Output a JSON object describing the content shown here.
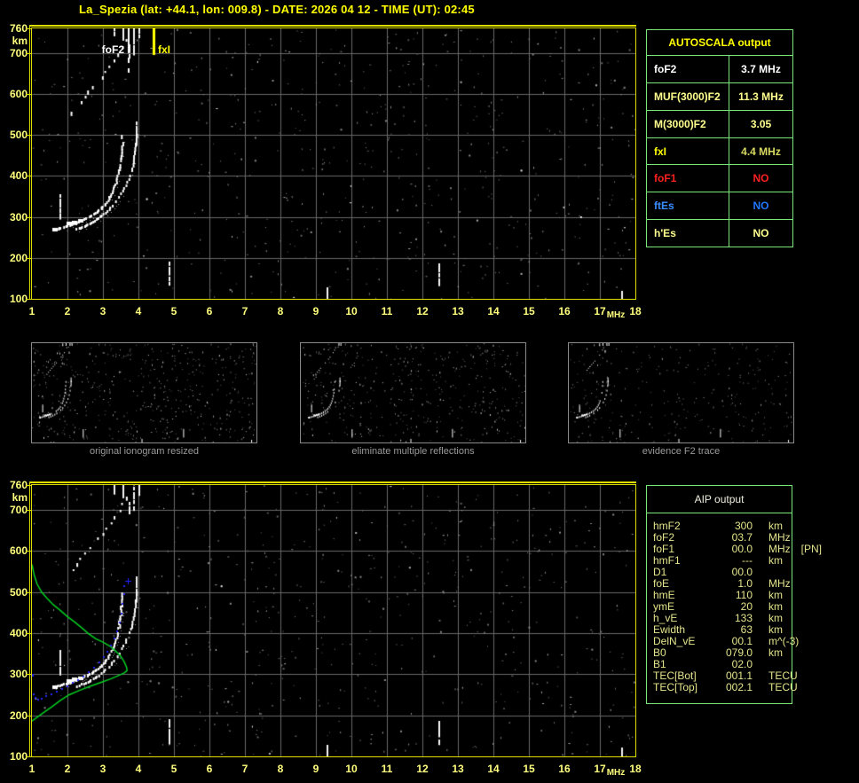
{
  "title": "La_Spezia (lat: +44.1, lon: 009.8) - DATE: 2026 04 12 - TIME (UT): 02:45",
  "colors": {
    "accent_yellow": "#ffff00",
    "pale_yellow": "#ffff8e",
    "tick_yellow": "#ffff7d",
    "table_green_border": "#79e879",
    "grid_grey": "#696969",
    "profile_green": "#00d022",
    "fit_blue": "#2424ff",
    "alert_red": "#ff2020",
    "info_blue": "#3b8eff"
  },
  "top_plot": {
    "fof2_label": "foF2",
    "fxi_label": "fxI"
  },
  "autoscala": {
    "header": "AUTOSCALA output",
    "rows": [
      {
        "label": "foF2",
        "value": "3.7 MHz",
        "label_color": "#ffffff",
        "value_color": "#ffffff"
      },
      {
        "label": "MUF(3000)F2",
        "value": "11.3 MHz",
        "label_color": "#ffff8e",
        "value_color": "#ffff8e"
      },
      {
        "label": "M(3000)F2",
        "value": "3.05",
        "label_color": "#ffff8e",
        "value_color": "#ffff8e"
      },
      {
        "label": "fxI",
        "value": "4.4 MHz",
        "label_color": "#ffff00",
        "value_color": "#d8d860"
      },
      {
        "label": "foF1",
        "value": "NO",
        "label_color": "#ff2020",
        "value_color": "#ff2020"
      },
      {
        "label": "ftEs",
        "value": "NO",
        "label_color": "#3b8eff",
        "value_color": "#2277ff"
      },
      {
        "label": "h'Es",
        "value": "NO",
        "label_color": "#ffff8e",
        "value_color": "#ffff8e"
      }
    ]
  },
  "thumbnails": [
    {
      "caption": "original ionogram resized"
    },
    {
      "caption": "eliminate multiple reflections"
    },
    {
      "caption": "evidence F2 trace"
    }
  ],
  "aip": {
    "header": "AIP output",
    "rows": [
      {
        "label": "hmF2",
        "value": "300",
        "unit": "km",
        "extra": ""
      },
      {
        "label": "foF2",
        "value": "03.7",
        "unit": "MHz",
        "extra": ""
      },
      {
        "label": "foF1",
        "value": "00.0",
        "unit": "MHz",
        "extra": "[PN]"
      },
      {
        "label": "hmF1",
        "value": "---",
        "unit": "km",
        "extra": ""
      },
      {
        "label": "D1",
        "value": "00.0",
        "unit": "",
        "extra": ""
      },
      {
        "label": "foE",
        "value": "1.0",
        "unit": "MHz",
        "extra": ""
      },
      {
        "label": "hmE",
        "value": "110",
        "unit": "km",
        "extra": ""
      },
      {
        "label": "ymE",
        "value": "20",
        "unit": "km",
        "extra": ""
      },
      {
        "label": "h_vE",
        "value": "133",
        "unit": "km",
        "extra": ""
      },
      {
        "label": "Ewidth",
        "value": "63",
        "unit": "km",
        "extra": ""
      },
      {
        "label": "DelN_vE",
        "value": "00.1",
        "unit": "m^(-3)",
        "extra": ""
      },
      {
        "label": "B0",
        "value": "079.0",
        "unit": "km",
        "extra": ""
      },
      {
        "label": "B1",
        "value": "02.0",
        "unit": "",
        "extra": ""
      },
      {
        "label": "TEC[Bot]",
        "value": "001.1",
        "unit": "TECU",
        "extra": ""
      },
      {
        "label": "TEC[Top]",
        "value": "002.1",
        "unit": "TECU",
        "extra": ""
      }
    ]
  },
  "chart_data": [
    {
      "id": "top_ionogram",
      "type": "scatter",
      "title": "ionogram with autoscaled characteristics",
      "xlabel": "MHz",
      "ylabel": "km",
      "xlim": [
        1,
        18
      ],
      "ylim": [
        100,
        760
      ],
      "x_ticks": [
        1,
        2,
        3,
        4,
        5,
        6,
        7,
        8,
        9,
        10,
        11,
        12,
        13,
        14,
        15,
        16,
        17,
        18
      ],
      "y_ticks": [
        760,
        700,
        600,
        500,
        400,
        300,
        200,
        100
      ],
      "grid": true,
      "markers": {
        "foF2_MHz": 3.7,
        "fxI_MHz": 4.4
      },
      "series": [
        {
          "name": "F2 O-mode trace",
          "points": [
            [
              1.6,
              272
            ],
            [
              1.72,
              274
            ],
            [
              1.84,
              277
            ],
            [
              1.96,
              280
            ],
            [
              2.08,
              283
            ],
            [
              2.2,
              287
            ],
            [
              2.32,
              291
            ],
            [
              2.44,
              296
            ],
            [
              2.56,
              301
            ],
            [
              2.68,
              307
            ],
            [
              2.8,
              314
            ],
            [
              2.92,
              322
            ],
            [
              3.02,
              331
            ],
            [
              3.12,
              342
            ],
            [
              3.2,
              354
            ],
            [
              3.27,
              367
            ],
            [
              3.33,
              381
            ],
            [
              3.38,
              397
            ],
            [
              3.43,
              415
            ],
            [
              3.47,
              436
            ],
            [
              3.5,
              458
            ],
            [
              3.52,
              482
            ],
            [
              3.54,
              508
            ]
          ]
        },
        {
          "name": "F2 X-mode trace",
          "points": [
            [
              2.25,
              273
            ],
            [
              2.4,
              278
            ],
            [
              2.55,
              284
            ],
            [
              2.7,
              291
            ],
            [
              2.85,
              299
            ],
            [
              3.0,
              309
            ],
            [
              3.15,
              321
            ],
            [
              3.3,
              335
            ],
            [
              3.45,
              352
            ],
            [
              3.58,
              372
            ],
            [
              3.7,
              395
            ],
            [
              3.79,
              421
            ],
            [
              3.86,
              450
            ],
            [
              3.91,
              481
            ],
            [
              3.94,
              512
            ]
          ]
        },
        {
          "name": "spread echo near foF2",
          "points": [
            [
              2.1,
              556
            ],
            [
              2.22,
              570
            ],
            [
              2.34,
              583
            ],
            [
              2.46,
              596
            ],
            [
              2.58,
              608
            ],
            [
              2.7,
              620
            ],
            [
              2.82,
              632
            ],
            [
              2.94,
              644
            ],
            [
              3.06,
              657
            ],
            [
              3.18,
              670
            ],
            [
              3.3,
              684
            ],
            [
              3.42,
              700
            ],
            [
              3.52,
              717
            ],
            [
              3.6,
              733
            ]
          ]
        },
        {
          "name": "bright leading blobs",
          "points": [
            [
              1.62,
              271
            ],
            [
              2.02,
              286
            ],
            [
              2.18,
              289
            ],
            [
              2.34,
              292
            ]
          ]
        },
        {
          "name": "vertical echo dashes [f,km1,km2]",
          "segments": [
            [
              1.78,
              300,
              352
            ],
            [
              3.93,
              478,
              532
            ],
            [
              4.85,
              132,
              188
            ],
            [
              12.45,
              133,
              190
            ],
            [
              9.3,
              100,
              124
            ],
            [
              17.6,
              100,
              118
            ]
          ]
        },
        {
          "name": "top spread dashes [f,km1,km2]",
          "segments": [
            [
              3.55,
              733,
              760
            ],
            [
              3.72,
              688,
              714
            ],
            [
              3.85,
              700,
              760
            ],
            [
              4.0,
              736,
              760
            ],
            [
              3.3,
              742,
              758
            ]
          ]
        }
      ]
    },
    {
      "id": "bottom_ionogram",
      "type": "scatter",
      "title": "ionogram with AIP inversion profile",
      "xlabel": "MHz",
      "ylabel": "km",
      "xlim": [
        1,
        18
      ],
      "ylim": [
        100,
        760
      ],
      "x_ticks": [
        1,
        2,
        3,
        4,
        5,
        6,
        7,
        8,
        9,
        10,
        11,
        12,
        13,
        14,
        15,
        16,
        17,
        18
      ],
      "y_ticks": [
        760,
        700,
        600,
        500,
        400,
        300,
        200,
        100
      ],
      "grid": true,
      "series_ref": "top_ionogram",
      "series": [
        {
          "name": "electron density profile (green)",
          "points": [
            [
              1.0,
              186
            ],
            [
              1.3,
              205
            ],
            [
              1.55,
              220
            ],
            [
              1.8,
              236
            ],
            [
              2.05,
              250
            ],
            [
              2.35,
              261
            ],
            [
              2.65,
              271
            ],
            [
              2.95,
              280
            ],
            [
              3.2,
              288
            ],
            [
              3.45,
              297
            ],
            [
              3.6,
              303
            ],
            [
              3.68,
              309
            ],
            [
              3.67,
              316
            ],
            [
              3.6,
              330
            ],
            [
              3.5,
              344
            ],
            [
              3.35,
              357
            ],
            [
              3.2,
              368
            ],
            [
              3.0,
              378
            ],
            [
              2.8,
              386
            ],
            [
              2.6,
              398
            ],
            [
              2.4,
              413
            ],
            [
              2.2,
              427
            ],
            [
              2.0,
              440
            ],
            [
              1.8,
              455
            ],
            [
              1.6,
              469
            ],
            [
              1.42,
              485
            ],
            [
              1.27,
              500
            ],
            [
              1.14,
              520
            ],
            [
              1.06,
              542
            ],
            [
              1.0,
              567
            ]
          ]
        },
        {
          "name": "restored h'(f) trace (blue)",
          "points": [
            [
              1.0,
              299
            ],
            [
              1.05,
              252
            ],
            [
              1.1,
              243
            ],
            [
              1.17,
              238
            ],
            [
              1.27,
              241
            ],
            [
              1.4,
              246
            ],
            [
              1.55,
              252
            ],
            [
              1.7,
              258
            ],
            [
              1.85,
              264
            ],
            [
              2.0,
              271
            ],
            [
              2.15,
              278
            ],
            [
              2.3,
              286
            ],
            [
              2.45,
              295
            ],
            [
              2.6,
              305
            ],
            [
              2.75,
              316
            ],
            [
              2.9,
              328
            ],
            [
              3.02,
              341
            ],
            [
              3.13,
              355
            ],
            [
              3.23,
              370
            ],
            [
              3.32,
              387
            ],
            [
              3.4,
              405
            ],
            [
              3.47,
              426
            ],
            [
              3.52,
              448
            ],
            [
              3.56,
              472
            ],
            [
              3.59,
              495
            ],
            [
              3.61,
              514
            ]
          ]
        },
        {
          "name": "blue isolated points",
          "points": [
            [
              3.7,
              526
            ]
          ]
        }
      ]
    },
    {
      "id": "autoscala_table",
      "type": "table",
      "title": "AUTOSCALA output",
      "rows": [
        [
          "foF2",
          "3.7 MHz"
        ],
        [
          "MUF(3000)F2",
          "11.3 MHz"
        ],
        [
          "M(3000)F2",
          "3.05"
        ],
        [
          "fxI",
          "4.4 MHz"
        ],
        [
          "foF1",
          "NO"
        ],
        [
          "ftEs",
          "NO"
        ],
        [
          "h'Es",
          "NO"
        ]
      ]
    },
    {
      "id": "aip_table",
      "type": "table",
      "title": "AIP output",
      "rows": [
        [
          "hmF2",
          "300",
          "km"
        ],
        [
          "foF2",
          "03.7",
          "MHz"
        ],
        [
          "foF1",
          "00.0",
          "MHz [PN]"
        ],
        [
          "hmF1",
          "---",
          "km"
        ],
        [
          "D1",
          "00.0",
          ""
        ],
        [
          "foE",
          "1.0",
          "MHz"
        ],
        [
          "hmE",
          "110",
          "km"
        ],
        [
          "ymE",
          "20",
          "km"
        ],
        [
          "h_vE",
          "133",
          "km"
        ],
        [
          "Ewidth",
          "63",
          "km"
        ],
        [
          "DelN_vE",
          "00.1",
          "m^(-3)"
        ],
        [
          "B0",
          "079.0",
          "km"
        ],
        [
          "B1",
          "02.0",
          ""
        ],
        [
          "TEC[Bot]",
          "001.1",
          "TECU"
        ],
        [
          "TEC[Top]",
          "002.1",
          "TECU"
        ]
      ]
    }
  ]
}
